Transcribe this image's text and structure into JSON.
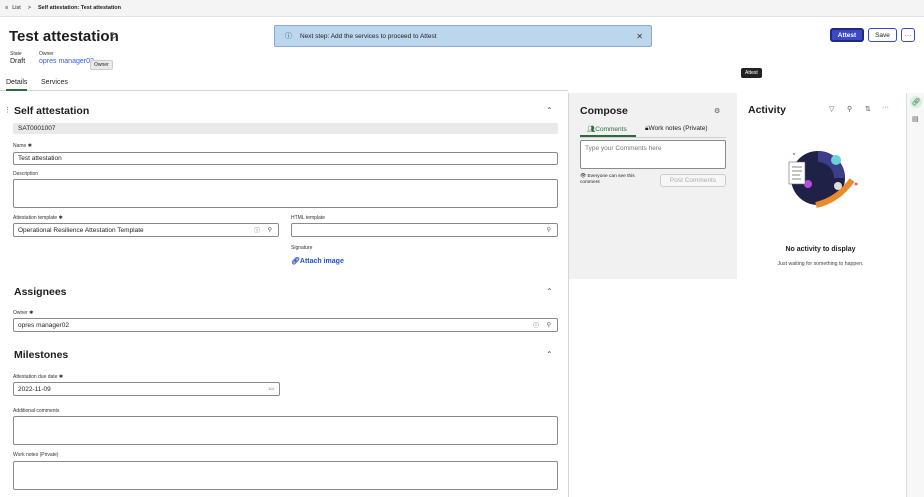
{
  "breadcrumb": {
    "list": "List",
    "sep": ">",
    "current": "Self attestation: Test attestation"
  },
  "header": {
    "title": "Test attestation",
    "state_label": "State",
    "state_value": "Draft",
    "owner_label": "Owner",
    "owner_value": "opres manager02",
    "owner_tooltip": "Owner"
  },
  "tabs": [
    "Details",
    "Services"
  ],
  "toast": {
    "message": "Next step: Add the services to proceed to Attest"
  },
  "actions": {
    "attest": "Attest",
    "save": "Save",
    "more": "···",
    "attest_tooltip": "Attest"
  },
  "self_attestation": {
    "title": "Self attestation",
    "number": "SAT0001007",
    "name_label": "Name",
    "name_value": "Test attestation",
    "description_label": "Description",
    "template_label": "Attestation template",
    "template_value": "Operational Resilience Attestation Template",
    "html_template_label": "HTML template",
    "signature_label": "Signature",
    "attach_image": "Attach image"
  },
  "assignees": {
    "title": "Assignees",
    "owner_label": "Owner",
    "owner_value": "opres manager02"
  },
  "milestones": {
    "title": "Milestones",
    "due_label": "Attestation due date",
    "due_value": "2022-11-09",
    "comments_label": "Additional comments",
    "worknotes_label": "Work notes (Private)"
  },
  "compose": {
    "title": "Compose",
    "tab_comments": "Comments",
    "tab_worknotes": "Work notes (Private)",
    "placeholder": "Type your Comments here",
    "visibility": "Everyone can see this comment",
    "post": "Post Comments"
  },
  "activity": {
    "title": "Activity",
    "empty_title": "No activity to display",
    "empty_sub": "Just waiting for something to happen."
  },
  "colors": {
    "primary": "#3b49c4",
    "toast": "#bcd6ed",
    "tab_active": "#2d6b3e",
    "link": "#2a5ee8"
  }
}
